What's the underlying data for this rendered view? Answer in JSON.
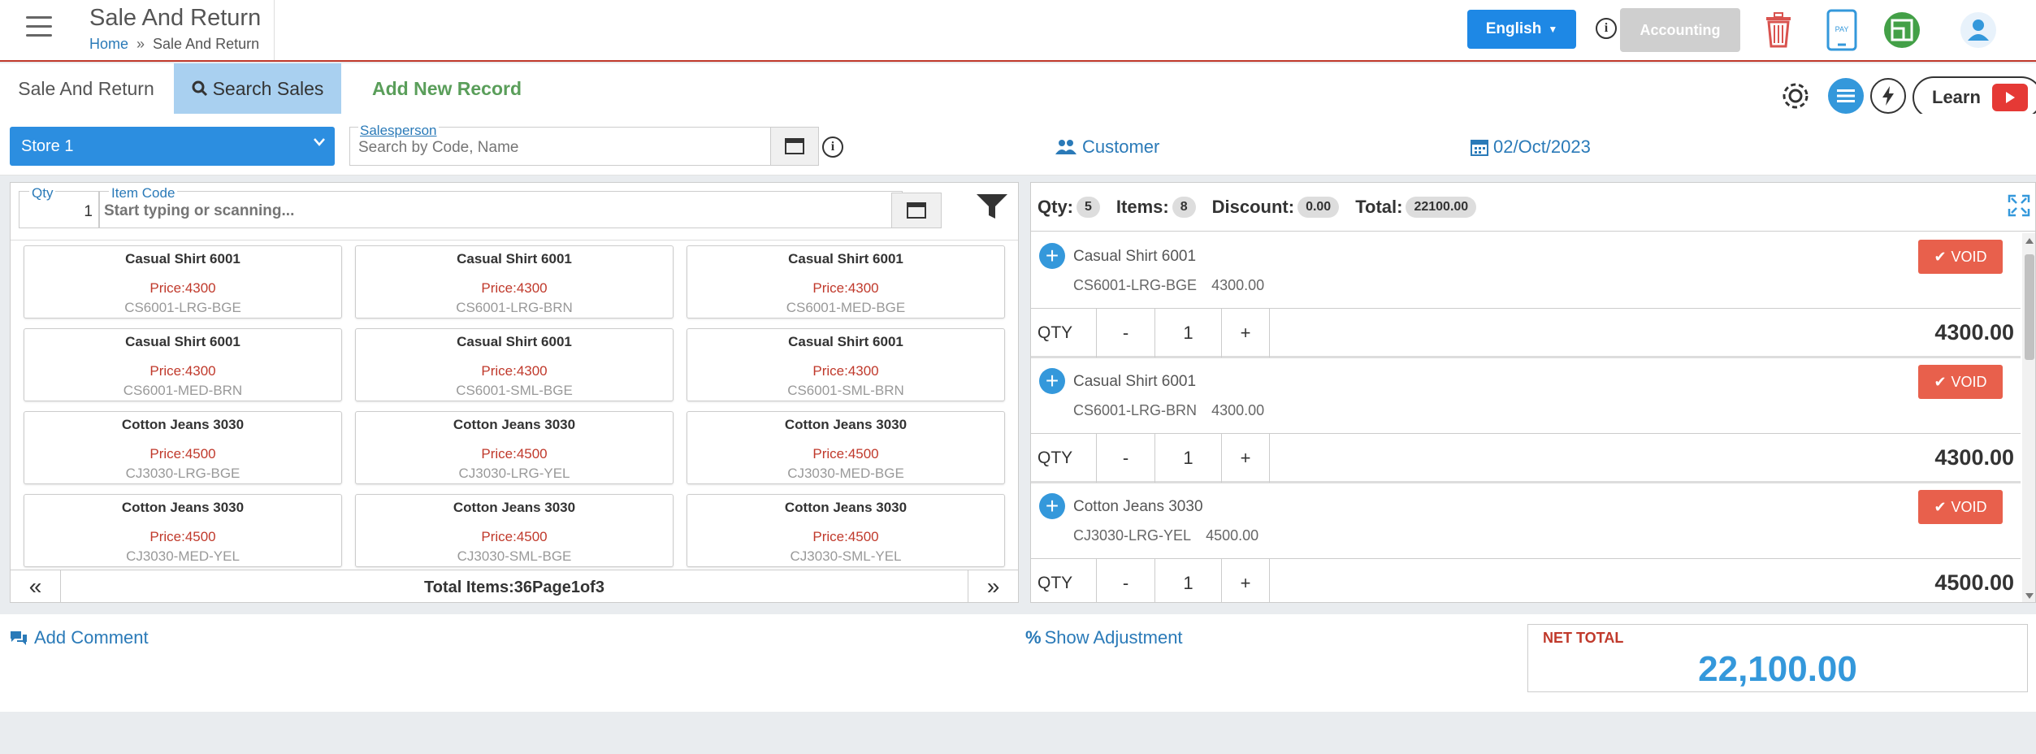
{
  "header": {
    "page_title": "Sale And Return",
    "breadcrumb_home": "Home",
    "breadcrumb_sep": "»",
    "breadcrumb_current": "Sale And Return",
    "language": "English",
    "info": "i",
    "accounting": "Accounting",
    "pay_label": "PAY"
  },
  "tabs": {
    "sale_and_return": "Sale And Return",
    "search_sales": "Search Sales",
    "add_new_record": "Add New Record",
    "learn": "Learn"
  },
  "filters": {
    "store": "Store 1",
    "salesperson_label": "Salesperson",
    "salesperson_placeholder": "Search by Code, Name",
    "customer": "Customer",
    "date": "02/Oct/2023"
  },
  "entry": {
    "qty_label": "Qty",
    "qty_value": "1",
    "item_code_label": "Item Code",
    "item_code_placeholder": "Start typing or scanning..."
  },
  "products": [
    {
      "name": "Casual Shirt 6001",
      "price": "Price:4300",
      "code": "CS6001-LRG-BGE"
    },
    {
      "name": "Casual Shirt 6001",
      "price": "Price:4300",
      "code": "CS6001-LRG-BRN"
    },
    {
      "name": "Casual Shirt 6001",
      "price": "Price:4300",
      "code": "CS6001-MED-BGE"
    },
    {
      "name": "Casual Shirt 6001",
      "price": "Price:4300",
      "code": "CS6001-MED-BRN"
    },
    {
      "name": "Casual Shirt 6001",
      "price": "Price:4300",
      "code": "CS6001-SML-BGE"
    },
    {
      "name": "Casual Shirt 6001",
      "price": "Price:4300",
      "code": "CS6001-SML-BRN"
    },
    {
      "name": "Cotton Jeans 3030",
      "price": "Price:4500",
      "code": "CJ3030-LRG-BGE"
    },
    {
      "name": "Cotton Jeans 3030",
      "price": "Price:4500",
      "code": "CJ3030-LRG-YEL"
    },
    {
      "name": "Cotton Jeans 3030",
      "price": "Price:4500",
      "code": "CJ3030-MED-BGE"
    },
    {
      "name": "Cotton Jeans 3030",
      "price": "Price:4500",
      "code": "CJ3030-MED-YEL"
    },
    {
      "name": "Cotton Jeans 3030",
      "price": "Price:4500",
      "code": "CJ3030-SML-BGE"
    },
    {
      "name": "Cotton Jeans 3030",
      "price": "Price:4500",
      "code": "CJ3030-SML-YEL"
    }
  ],
  "pager": {
    "prev": "«",
    "next": "»",
    "text": "Total Items:36Page1of3"
  },
  "summary": {
    "qty_label": "Qty:",
    "qty": "5",
    "items_label": "Items:",
    "items": "8",
    "discount_label": "Discount:",
    "discount": "0.00",
    "total_label": "Total:",
    "total": "22100.00"
  },
  "cart": [
    {
      "name": "Casual Shirt 6001",
      "code": "CS6001-LRG-BGE",
      "price": "4300.00",
      "qty": "1",
      "line_total": "4300.00"
    },
    {
      "name": "Casual Shirt 6001",
      "code": "CS6001-LRG-BRN",
      "price": "4300.00",
      "qty": "1",
      "line_total": "4300.00"
    },
    {
      "name": "Cotton Jeans 3030",
      "code": "CJ3030-LRG-YEL",
      "price": "4500.00",
      "qty": "1",
      "line_total": "4500.00"
    }
  ],
  "cart_labels": {
    "void": "VOID",
    "qty": "QTY",
    "minus": "-",
    "plus": "+"
  },
  "bottom": {
    "add_comment": "Add Comment",
    "show_adjustment": "Show Adjustment",
    "net_total_label": "NET TOTAL",
    "net_total_value": "22,100.00"
  },
  "colors": {
    "primary_blue": "#1e88e5",
    "void_red": "#e8604c",
    "price_red": "#c0392b",
    "link_blue": "#2a7ab8",
    "add_green": "#5a9e5a"
  }
}
